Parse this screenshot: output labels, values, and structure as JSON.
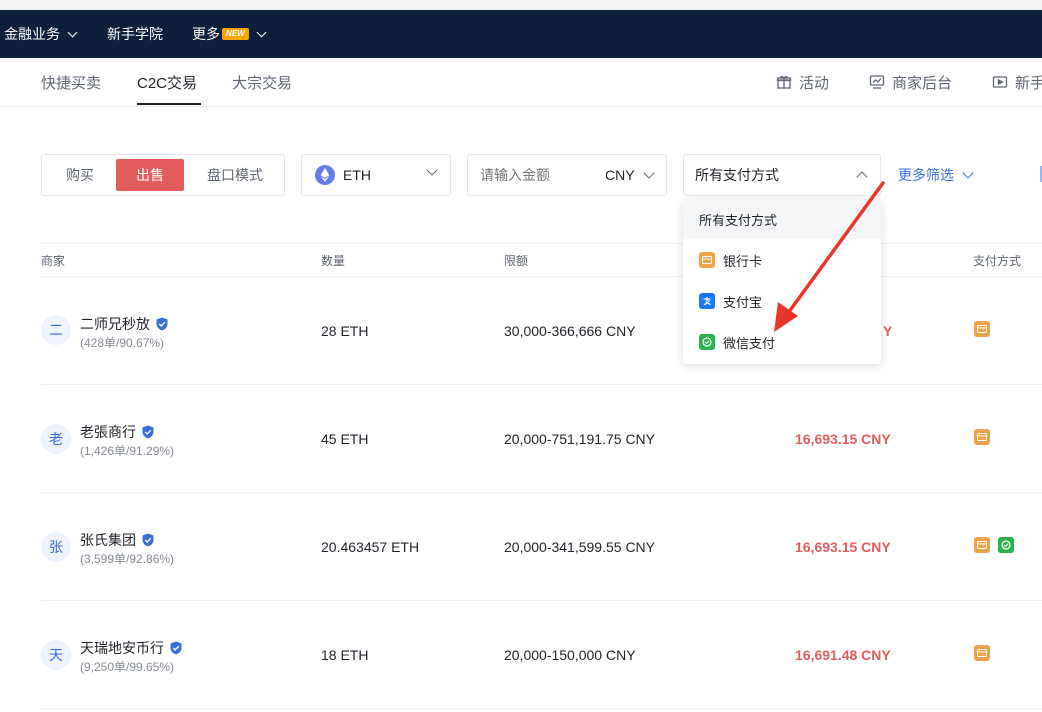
{
  "navbar": {
    "items": [
      {
        "label": "金融业务",
        "has_dropdown": true
      },
      {
        "label": "新手学院",
        "has_dropdown": false
      },
      {
        "label": "更多",
        "badge": "NEW",
        "has_dropdown": true
      }
    ]
  },
  "subnav": {
    "tabs": [
      {
        "label": "快捷买卖",
        "active": false
      },
      {
        "label": "C2C交易",
        "active": true
      },
      {
        "label": "大宗交易",
        "active": false
      }
    ],
    "right_links": [
      {
        "label": "活动",
        "icon": "gift-icon"
      },
      {
        "label": "商家后台",
        "icon": "merchant-dashboard-icon"
      },
      {
        "label": "新手",
        "icon": "video-play-icon"
      }
    ]
  },
  "filters": {
    "trade_modes": [
      {
        "label": "购买",
        "active": false
      },
      {
        "label": "出售",
        "active": true
      },
      {
        "label": "盘口模式",
        "active": false
      }
    ],
    "coin": {
      "value": "ETH",
      "icon": "ethereum-icon"
    },
    "amount": {
      "placeholder": "请输入金额",
      "value": "",
      "currency": "CNY"
    },
    "payment": {
      "value": "所有支付方式",
      "open": true
    },
    "more_label": "更多筛选"
  },
  "payment_dropdown": {
    "options": [
      {
        "label": "所有支付方式",
        "icon": "",
        "selected": true
      },
      {
        "label": "银行卡",
        "icon": "bank-card-icon",
        "selected": false
      },
      {
        "label": "支付宝",
        "icon": "alipay-icon",
        "selected": false
      },
      {
        "label": "微信支付",
        "icon": "wechat-pay-icon",
        "selected": false
      }
    ]
  },
  "table": {
    "headers": {
      "merchant": "商家",
      "quantity": "数量",
      "limit": "限额",
      "payment": "支付方式"
    },
    "rows": [
      {
        "avatar": "二",
        "name": "二师兄秒放",
        "stats": "(428单/90.67%)",
        "quantity": "28 ETH",
        "limit": "30,000-366,666 CNY",
        "price": "Y",
        "payments": [
          "bank-card-icon"
        ]
      },
      {
        "avatar": "老",
        "name": "老張商行",
        "stats": "(1,426单/91.29%)",
        "quantity": "45 ETH",
        "limit": "20,000-751,191.75 CNY",
        "price": "16,693.15 CNY",
        "payments": [
          "bank-card-icon"
        ]
      },
      {
        "avatar": "张",
        "name": "张氏集团",
        "stats": "(3,599单/92.86%)",
        "quantity": "20.463457 ETH",
        "limit": "20,000-341,599.55 CNY",
        "price": "16,693.15 CNY",
        "payments": [
          "bank-card-icon",
          "wechat-pay-icon"
        ]
      },
      {
        "avatar": "天",
        "name": "天瑞地安币行",
        "stats": "(9,250单/99.65%)",
        "quantity": "18 ETH",
        "limit": "20,000-150,000 CNY",
        "price": "16,691.48 CNY",
        "payments": [
          "bank-card-icon"
        ]
      }
    ]
  },
  "colors": {
    "navbar_bg": "#0c1f3d",
    "sell_active": "#e25c5c",
    "price": "#e25c5c",
    "link_blue": "#3a6fd8",
    "bank_icon": "#f0a24a",
    "wechat_icon": "#2bb24c",
    "alipay_icon": "#1677ff",
    "annotation_arrow": "#e8352b"
  }
}
